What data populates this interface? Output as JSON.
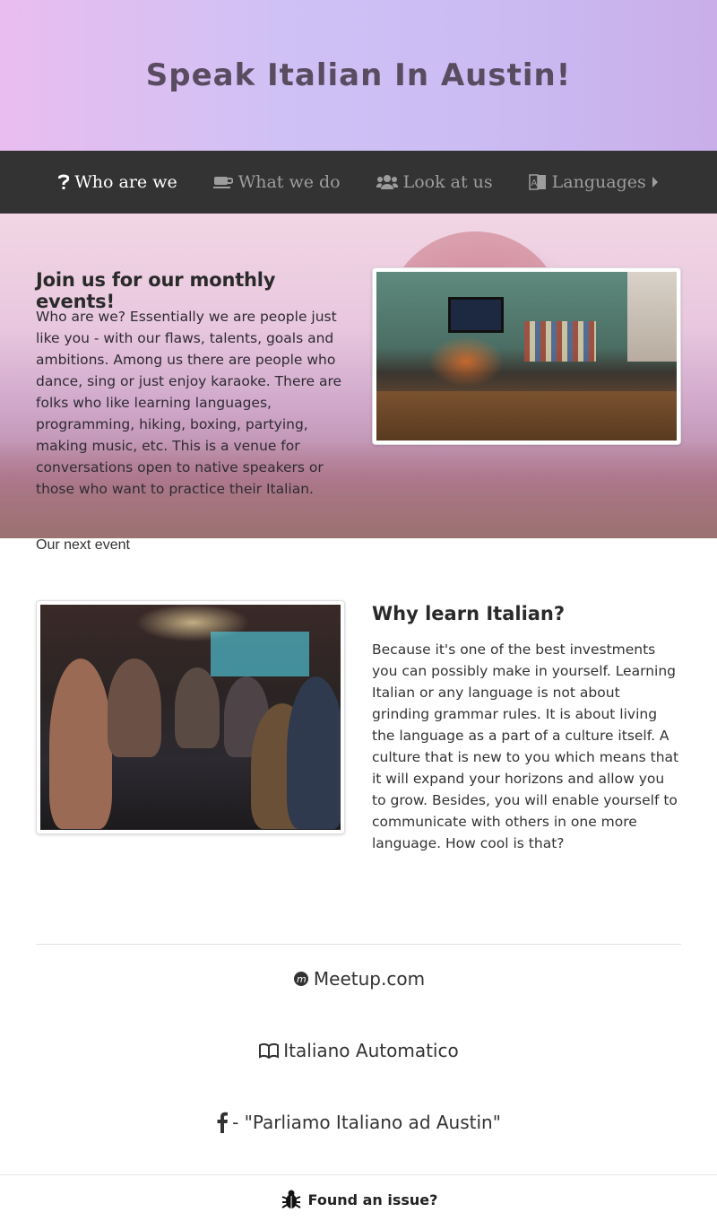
{
  "header": {
    "title": "Speak Italian In Austin!"
  },
  "nav": {
    "items": [
      {
        "label": "Who are we",
        "icon": "question-icon"
      },
      {
        "label": "What we do",
        "icon": "coffee-icon"
      },
      {
        "label": "Look at us",
        "icon": "users-icon"
      },
      {
        "label": "Languages",
        "icon": "language-icon"
      }
    ]
  },
  "hero": {
    "heading": "Join us for our monthly events!",
    "text": "Who are we? Essentially we are people just like you - with our flaws, talents, goals and ambitions. Among us there are people who dance, sing or just enjoy karaoke. There are folks who like learning languages, programming, hiking, boxing, partying, making music, etc. This is a venue for conversations open to native speakers or those who want to practice their Italian.",
    "next_event": "Our next event"
  },
  "why": {
    "heading": "Why learn Italian?",
    "text": "Because it's one of the best investments you can possibly make in yourself. Learning Italian or any language is not about grinding grammar rules. It is about living the language as a part of a culture itself. A culture that is new to you which means that it will expand your horizons and allow you to grow. Besides, you will enable yourself to communicate with others in one more language. How cool is that?"
  },
  "links": {
    "meetup": "Meetup.com",
    "italiano_automatico": "Italiano Automatico",
    "facebook": "- \"Parliamo Italiano ad Austin\""
  },
  "footer": {
    "issue": "Found an issue?"
  },
  "colors": {
    "nav_bg": "#333333",
    "nav_active": "#ffffff",
    "nav_inactive": "#9d9d9d"
  }
}
